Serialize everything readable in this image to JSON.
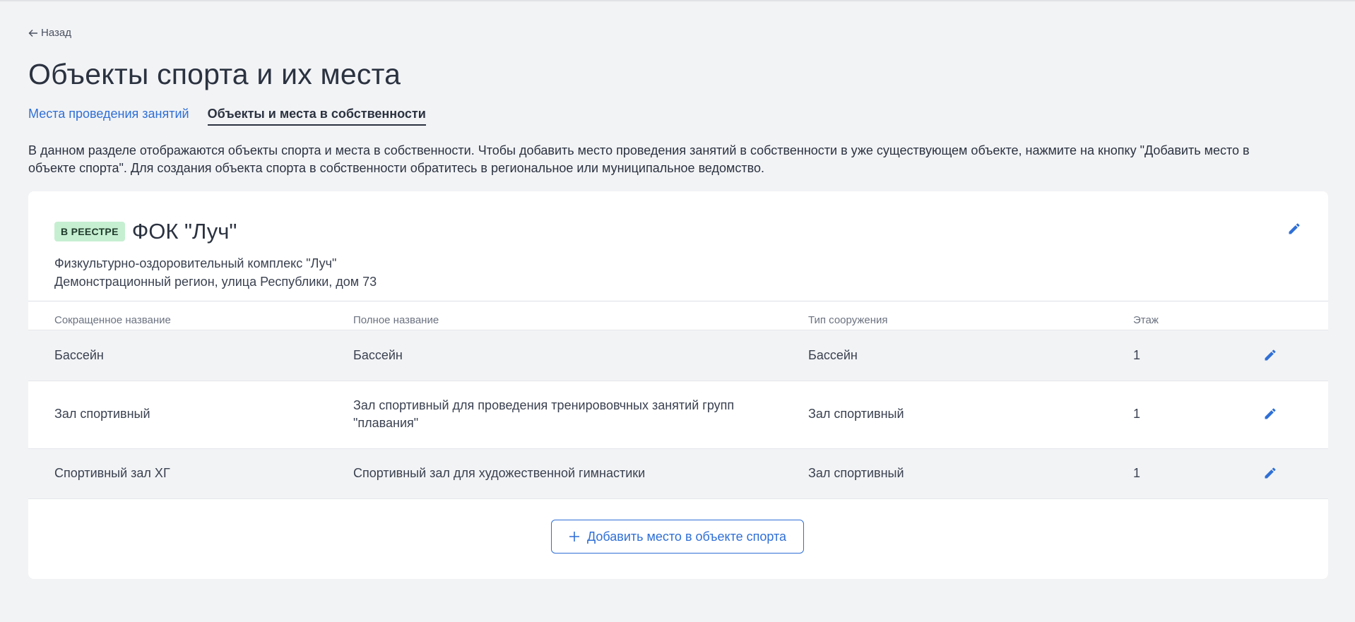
{
  "back": {
    "label": "Назад",
    "icon": "arrow-left-icon"
  },
  "page_title": "Объекты спорта и их места",
  "tabs": [
    {
      "label": "Места проведения занятий",
      "active": false
    },
    {
      "label": "Объекты и места в собственности",
      "active": true
    }
  ],
  "description": "В данном разделе отображаются объекты спорта и места в собственности. Чтобы добавить место проведения занятий в собственности в уже существующем объекте, нажмите на кнопку \"Добавить место в объекте спорта\". Для создания объекта спорта в собственности обратитесь в региональное или муниципальное ведомство.",
  "facility": {
    "badge": "В РЕЕСТРЕ",
    "title": "ФОК \"Луч\"",
    "full_name": "Физкультурно-оздоровительный комплекс \"Луч\"",
    "address": "Демонстрационный регион, улица Республики, дом 73",
    "edit_icon": "pencil-icon"
  },
  "table": {
    "headers": [
      "Сокращенное название",
      "Полное название",
      "Тип сооружения",
      "Этаж"
    ],
    "rows": [
      {
        "short": "Бассейн",
        "full": "Бассейн",
        "type": "Бассейн",
        "floor": "1"
      },
      {
        "short": "Зал спортивный",
        "full": "Зал спортивный для проведения тренирововчных занятий групп \"плавания\"",
        "type": "Зал спортивный",
        "floor": "1"
      },
      {
        "short": "Спортивный зал ХГ",
        "full": "Спортивный зал для художественной гимнастики",
        "type": "Зал спортивный",
        "floor": "1"
      }
    ]
  },
  "add_button": {
    "label": "Добавить место в объекте спорта",
    "icon": "plus-icon"
  },
  "colors": {
    "accent": "#2f6fd6",
    "background": "#f2f3f5",
    "badge_bg": "#c6efd1"
  }
}
